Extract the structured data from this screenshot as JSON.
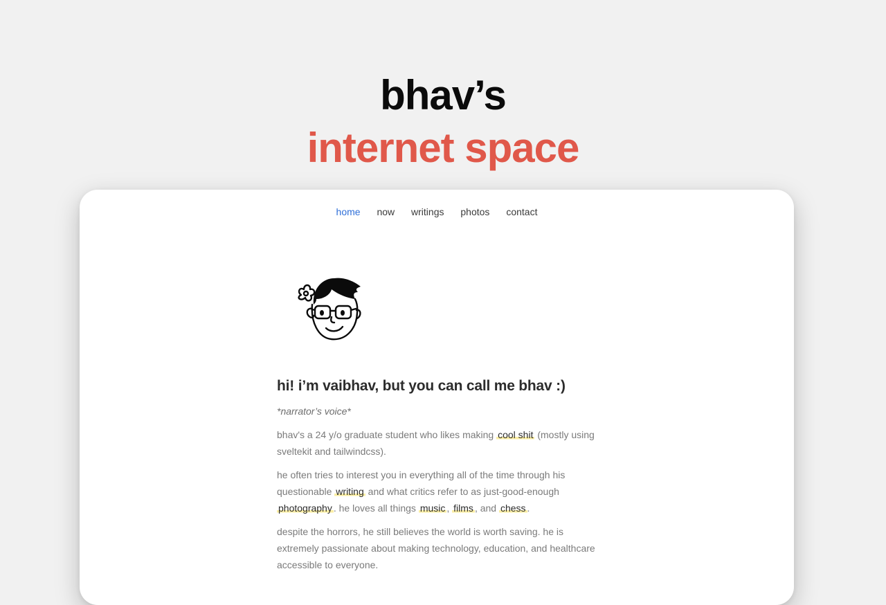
{
  "hero": {
    "line1": "bhav’s",
    "line2": "internet space"
  },
  "nav": {
    "items": [
      {
        "label": "home",
        "active": true
      },
      {
        "label": "now"
      },
      {
        "label": "writings"
      },
      {
        "label": "photos"
      },
      {
        "label": "contact"
      }
    ]
  },
  "intro": {
    "heading": "hi! i’m vaibhav, but you can call me bhav :)",
    "narrator": "*narrator’s voice*",
    "p1": {
      "before": "bhav's a 24 y/o graduate student who likes making ",
      "link": "cool shit",
      "after": " (mostly using sveltekit and tailwindcss)."
    },
    "p2": {
      "before": "he often tries to interest you in everything all of the time through his questionable ",
      "link_writing": "writing",
      "mid1": " and what critics refer to as just-good-enough ",
      "link_photography": "photography",
      "mid2": ". he loves all things ",
      "link_music": "music",
      "comma1": ", ",
      "link_films": "films",
      "mid3": ", and ",
      "link_chess": "chess",
      "end": "."
    },
    "p3": "despite the horrors, he still believes the world is worth saving. he is extremely passionate about making technology, education, and healthcare accessible to everyone."
  },
  "colors": {
    "background": "#f1f1f1",
    "accent_red": "#e0584a",
    "nav_active": "#2f6fd8",
    "highlight": "#fbeea3"
  },
  "icons": {
    "avatar": "cartoon-avatar-with-glasses"
  }
}
